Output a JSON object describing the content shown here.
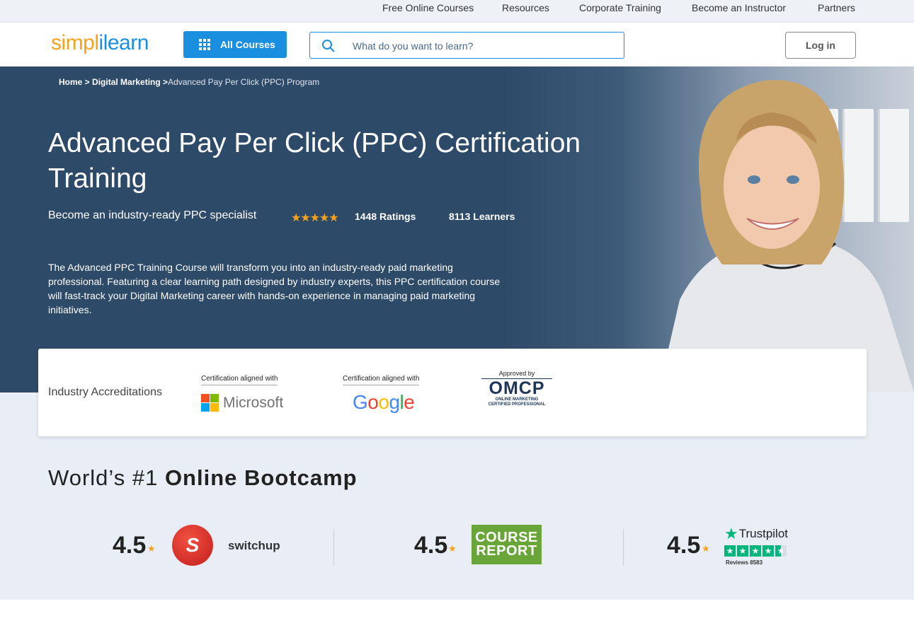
{
  "utility_nav": [
    "Free Online Courses",
    "Resources",
    "Corporate Training",
    "Become an Instructor",
    "Partners"
  ],
  "header": {
    "logo_part1": "simpl",
    "logo_part2": "i",
    "logo_part3": "learn",
    "all_courses_label": "All Courses",
    "search_placeholder": "What do you want to learn?",
    "login_label": "Log in"
  },
  "breadcrumb": {
    "home": "Home",
    "sep1": " > ",
    "category": "Digital Marketing",
    "sep2": " >",
    "current": "Advanced Pay Per Click (PPC) Program"
  },
  "hero": {
    "title": "Advanced Pay Per Click (PPC) Certification Training",
    "subtitle": "Become an industry-ready PPC specialist",
    "star_glyphs": "★★★★★",
    "ratings": "1448 Ratings",
    "learners": "8113 Learners",
    "description": "The Advanced PPC Training Course will transform you into an industry-ready paid marketing professional. Featuring a clear learning path designed by industry experts, this PPC certification course will fast-track your Digital Marketing career with hands-on experience in managing paid marketing initiatives."
  },
  "accreditations": {
    "label": "Industry Accreditations",
    "microsoft_caption": "Certification aligned with",
    "microsoft_name": "Microsoft",
    "google_caption": "Certification aligned with",
    "google_name": "Google",
    "omcp_caption": "Approved by",
    "omcp_name": "OMCP",
    "omcp_line1": "ONLINE MARKETING",
    "omcp_line2": "CERTIFIED PROFESSIONAL"
  },
  "bootcamp": {
    "heading_plain": "World’s #1 ",
    "heading_bold": "Online Bootcamp",
    "reviews": [
      {
        "score": "4.5",
        "platform": "switchup"
      },
      {
        "score": "4.5",
        "platform_line1": "COURSE",
        "platform_line2": "REPORT"
      },
      {
        "score": "4.5",
        "platform": "Trustpilot",
        "reviews_count": "Reviews 8583"
      }
    ]
  },
  "colors": {
    "brand_blue": "#1a8fe0",
    "brand_orange": "#f7a21a",
    "hero_bg": "#2d4a68",
    "trustpilot_green": "#00b67a"
  }
}
